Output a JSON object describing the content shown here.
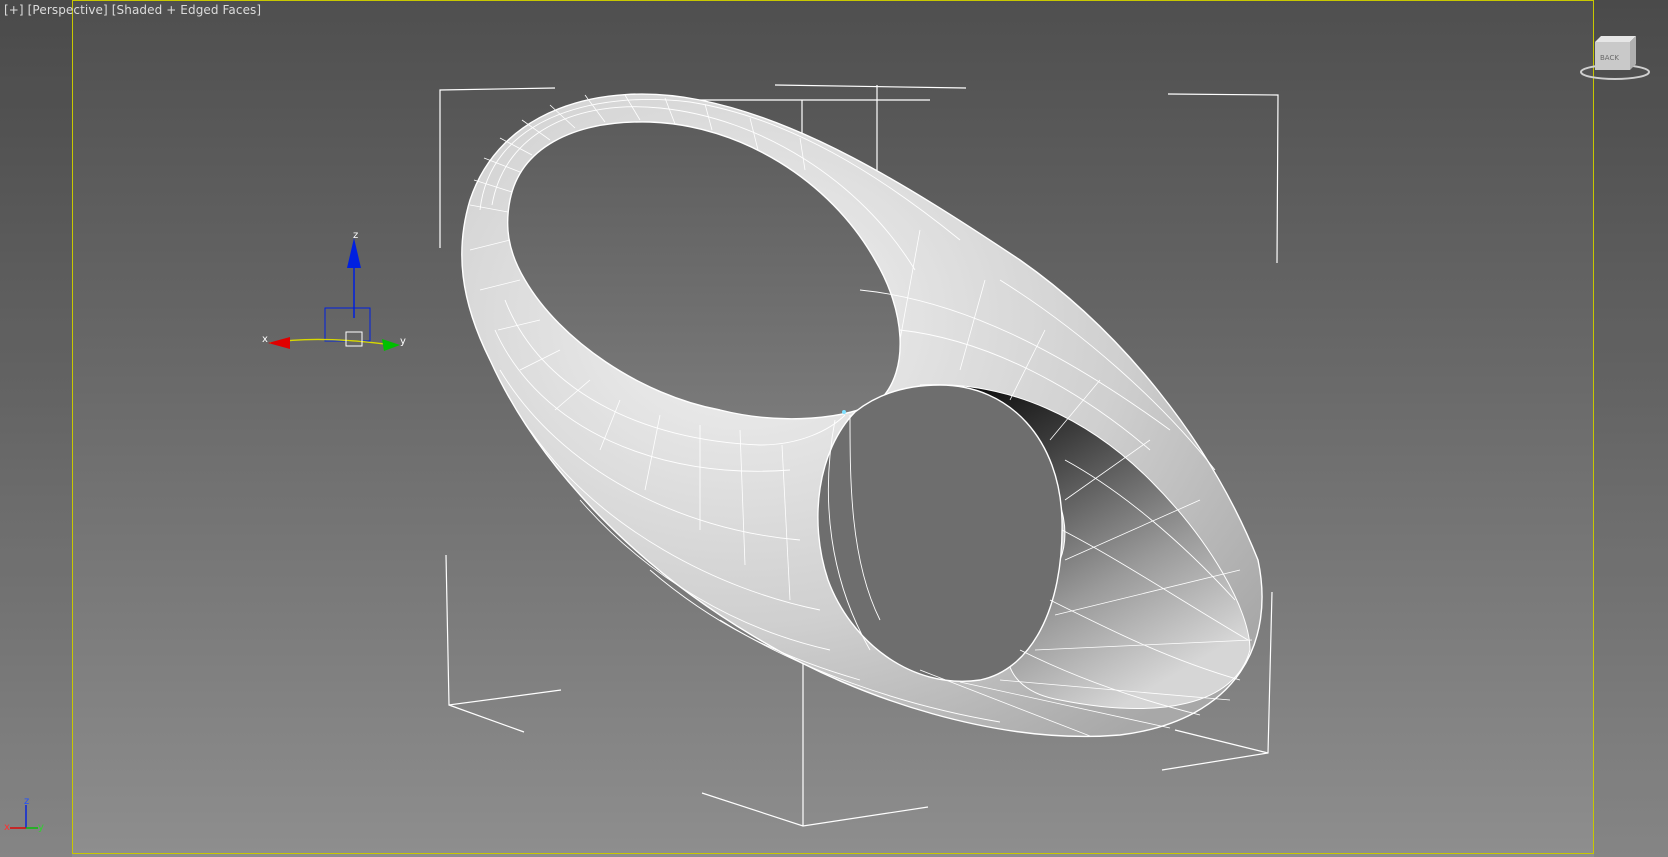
{
  "viewport": {
    "label_plus": "[+]",
    "label_view": "[Perspective]",
    "label_shading": "[Shaded + Edged Faces]"
  },
  "gizmo": {
    "x_label": "x",
    "y_label": "y",
    "z_label": "z"
  },
  "view_axis": {
    "x_label": "x",
    "y_label": "y",
    "z_label": "z"
  },
  "viewcube": {
    "face_text": "BACK"
  },
  "colors": {
    "axis_x": "#e00000",
    "axis_y": "#00c000",
    "axis_z": "#0020e0",
    "gizmo_plane": "#d8d800",
    "safe_frame": "#c8c800",
    "wire": "#ffffff"
  }
}
